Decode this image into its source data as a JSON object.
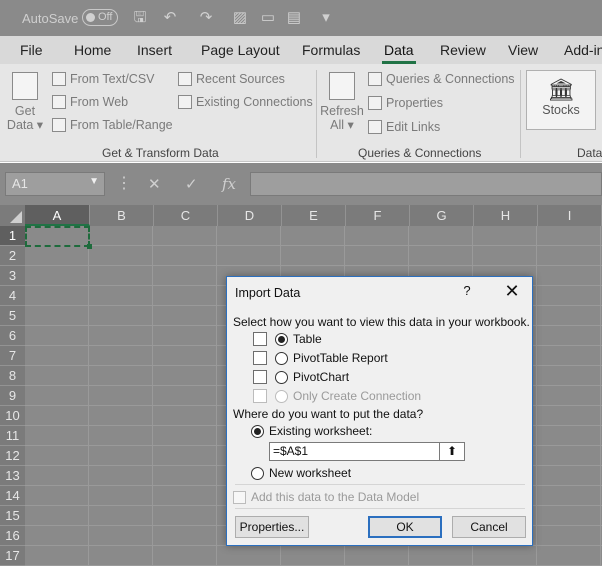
{
  "titlebar": {
    "autosave_label": "AutoSave",
    "autosave_state": "Off"
  },
  "tabs": [
    "File",
    "Home",
    "Insert",
    "Page Layout",
    "Formulas",
    "Data",
    "Review",
    "View",
    "Add-in"
  ],
  "ribbon": {
    "get_data": {
      "line1": "Get",
      "line2": "Data ▾"
    },
    "from_text_csv": "From Text/CSV",
    "from_web": "From Web",
    "from_table_range": "From Table/Range",
    "recent_sources": "Recent Sources",
    "existing_connections": "Existing Connections",
    "group_get_transform": "Get & Transform Data",
    "refresh_all": {
      "line1": "Refresh",
      "line2": "All ▾"
    },
    "queries_connections": "Queries & Connections",
    "properties": "Properties",
    "edit_links": "Edit Links",
    "group_queries": "Queries & Connections",
    "stocks": "Stocks",
    "group_data": "Data"
  },
  "formula_bar": {
    "name_box": "A1",
    "cancel": "✕",
    "enter": "✓",
    "fx": "fx"
  },
  "grid": {
    "columns": [
      "A",
      "B",
      "C",
      "D",
      "E",
      "F",
      "G",
      "H",
      "I"
    ],
    "rows": [
      "1",
      "2",
      "3",
      "4",
      "5",
      "6",
      "7",
      "8",
      "9",
      "10",
      "11",
      "12",
      "13",
      "14",
      "15",
      "16",
      "17"
    ]
  },
  "dialog": {
    "title": "Import Data",
    "help": "?",
    "close": "✕",
    "prompt_view": "Select how you want to view this data in your workbook.",
    "options": {
      "table": "Table",
      "pivottable": "PivotTable Report",
      "pivotchart": "PivotChart",
      "only_connection": "Only Create Connection"
    },
    "prompt_put": "Where do you want to put the data?",
    "existing_worksheet": "Existing worksheet:",
    "reference_value": "=$A$1",
    "new_worksheet": "New worksheet",
    "data_model": "Add this data to the Data Model",
    "properties_button": "Properties...",
    "ok_button": "OK",
    "cancel_button": "Cancel"
  }
}
